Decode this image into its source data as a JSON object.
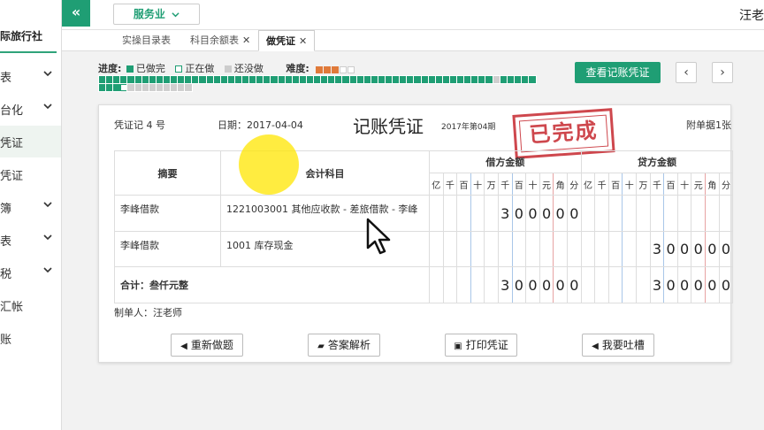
{
  "sidebar": {
    "title": "际旅行社",
    "items": [
      {
        "label": "表",
        "has_chevron": true,
        "active": false
      },
      {
        "label": "台化",
        "has_chevron": true,
        "active": false
      },
      {
        "label": "凭证",
        "has_chevron": false,
        "active": true
      },
      {
        "label": "凭证",
        "has_chevron": false,
        "active": false
      },
      {
        "label": "簿",
        "has_chevron": true,
        "active": false
      },
      {
        "label": "表",
        "has_chevron": true,
        "active": false
      },
      {
        "label": "税",
        "has_chevron": true,
        "active": false
      },
      {
        "label": "汇帐",
        "has_chevron": false,
        "active": false
      },
      {
        "label": "账",
        "has_chevron": false,
        "active": false
      }
    ]
  },
  "topbar": {
    "collapse_icon": "«",
    "service_label": "服务业",
    "user_name": "汪老"
  },
  "tabs": [
    {
      "label": "实操目录表",
      "closable": false,
      "active": false
    },
    {
      "label": "科目余额表",
      "closable": true,
      "active": false
    },
    {
      "label": "做凭证",
      "closable": true,
      "active": true
    }
  ],
  "progress": {
    "progress_label": "进度:",
    "legend_done": "已做完",
    "legend_doing": "正在做",
    "legend_todo": "还没做",
    "difficulty_label": "难度:",
    "difficulty_stars_filled": 3,
    "difficulty_stars_total": 5,
    "row1": [
      "done",
      "done",
      "done",
      "done",
      "done",
      "done",
      "done",
      "done",
      "done",
      "done",
      "done",
      "done",
      "done",
      "done",
      "done",
      "done",
      "done",
      "done",
      "done",
      "done",
      "done",
      "done",
      "done",
      "done",
      "done",
      "done",
      "done",
      "done",
      "done",
      "done",
      "done",
      "done",
      "done",
      "done",
      "done",
      "done",
      "done",
      "done",
      "done",
      "done",
      "done",
      "done",
      "done",
      "done",
      "done",
      "done",
      "done",
      "done",
      "done",
      "done",
      "done",
      "done",
      "done",
      "done",
      "done",
      "todo",
      "done",
      "done",
      "done",
      "done",
      "done"
    ],
    "row2": [
      "done",
      "done",
      "done",
      "doing",
      "todo",
      "todo",
      "todo",
      "todo",
      "todo",
      "todo",
      "todo",
      "todo",
      "todo"
    ]
  },
  "actions": {
    "view_voucher_label": "查看记账凭证",
    "prev_icon": "‹",
    "next_icon": "›"
  },
  "voucher": {
    "number": "凭证记 4 号",
    "date": "日期：2017-04-04",
    "title": "记账凭证",
    "period": "2017年第04期",
    "attachments": "附单据1张",
    "stamp": "已完成",
    "header_summary": "摘要",
    "header_account": "会计科目",
    "header_debit": "借方金额",
    "header_credit": "贷方金额",
    "units": [
      "亿",
      "千",
      "百",
      "十",
      "万",
      "千",
      "百",
      "十",
      "元",
      "角",
      "分"
    ],
    "rows": [
      {
        "summary": "李峰借款",
        "account": "1221003001 其他应收款 - 差旅借款 - 李峰",
        "debit": [
          "",
          "",
          "",
          "",
          "",
          "3",
          "0",
          "0",
          "0",
          "0",
          "0"
        ],
        "credit": [
          "",
          "",
          "",
          "",
          "",
          "",
          "",
          "",
          "",
          "",
          ""
        ]
      },
      {
        "summary": "李峰借款",
        "account": "1001 库存现金",
        "debit": [
          "",
          "",
          "",
          "",
          "",
          "",
          "",
          "",
          "",
          "",
          ""
        ],
        "credit": [
          "",
          "",
          "",
          "",
          "",
          "3",
          "0",
          "0",
          "0",
          "0",
          "0"
        ]
      }
    ],
    "total_label": "合计：叁仟元整",
    "total_debit": [
      "",
      "",
      "",
      "",
      "",
      "3",
      "0",
      "0",
      "0",
      "0",
      "0"
    ],
    "total_credit": [
      "",
      "",
      "",
      "",
      "",
      "3",
      "0",
      "0",
      "0",
      "0",
      "0"
    ],
    "maker": "制单人：汪老师"
  },
  "bottom_buttons": {
    "redo": "重新做题",
    "answer": "答案解析",
    "print": "打印凭证",
    "complain": "我要吐槽"
  },
  "colors": {
    "accent": "#1f9e74",
    "stamp": "#c9343a"
  }
}
